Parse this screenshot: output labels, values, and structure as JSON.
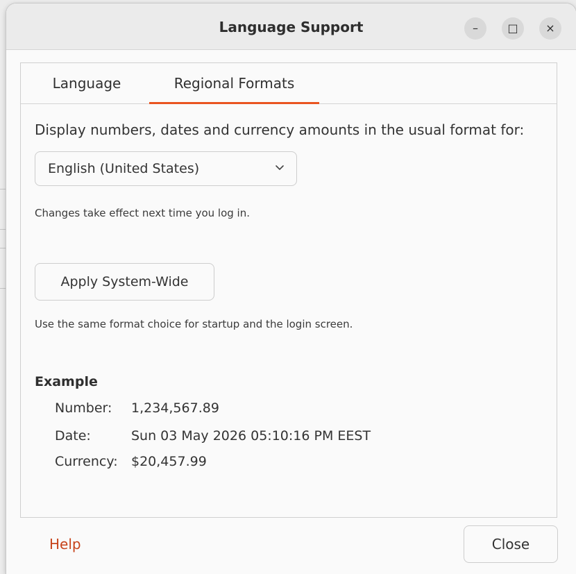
{
  "window": {
    "title": "Language Support",
    "controls": {
      "minimize": "–",
      "maximize": "□",
      "close": "×"
    }
  },
  "tabs": [
    {
      "label": "Language",
      "active": false
    },
    {
      "label": "Regional Formats",
      "active": true
    }
  ],
  "regional": {
    "description": "Display numbers, dates and currency amounts in the usual format for:",
    "selected_format": "English (United States)",
    "note_login": "Changes take effect next time you log in.",
    "apply_label": "Apply System-Wide",
    "note_system": "Use the same format choice for startup and the login screen."
  },
  "example": {
    "title": "Example",
    "number_label": "Number:",
    "number_value": "1,234,567.89",
    "date_label": "Date:",
    "date_value": "Sun 03 May 2026 05:10:16 PM EEST",
    "currency_label": "Currency:",
    "currency_value": "$20,457.99"
  },
  "footer": {
    "help_label": "Help",
    "close_label": "Close"
  },
  "colors": {
    "accent": "#e95420",
    "help_link": "#c7431a"
  },
  "icons": {
    "dropdown": "chevron-down-icon"
  }
}
